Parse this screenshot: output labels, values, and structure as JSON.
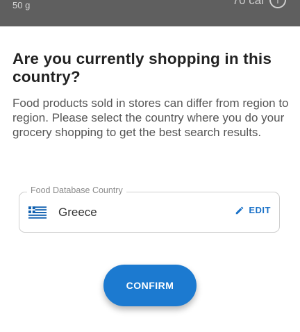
{
  "background_screen": {
    "serving_weight": "50 g",
    "calories": "70 cal",
    "icon": "info-circle-icon"
  },
  "dialog": {
    "title": "Are you currently shopping in this country?",
    "description": "Food products sold in stores can differ from region to region. Please select the country where you do your grocery shopping to get the best search results.",
    "country_field": {
      "label": "Food Database Country",
      "value": "Greece",
      "flag_icon": "greece-flag-icon",
      "edit_label": "EDIT",
      "edit_icon": "pencil-icon"
    },
    "confirm_label": "CONFIRM"
  },
  "colors": {
    "accent": "#1c7ad0",
    "edit_text": "#1b72c8",
    "backdrop": "#5f5f5f"
  }
}
